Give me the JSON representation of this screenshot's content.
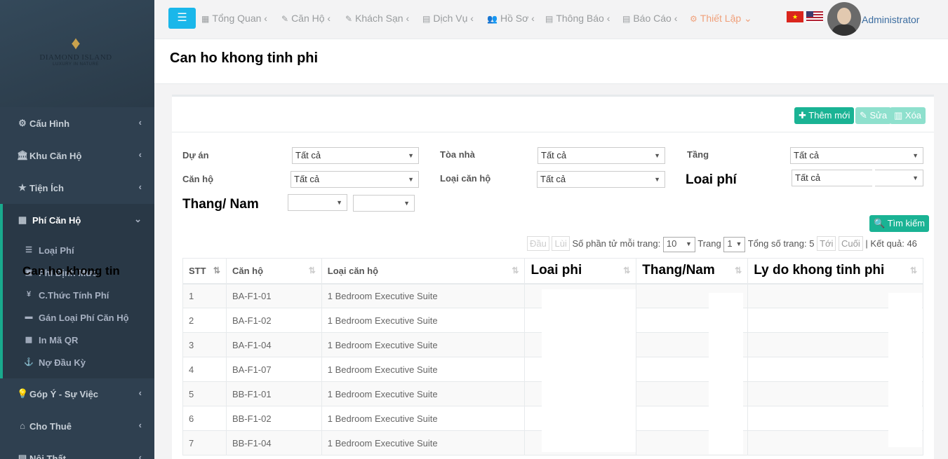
{
  "sidebar": {
    "logo": {
      "brand": "DIAMOND ISLAND",
      "tagline": "LUXURY IN NATURE"
    },
    "items": [
      {
        "label": "Cấu Hình",
        "icon": "gear-icon",
        "glyph": "⚙"
      },
      {
        "label": "Khu Căn Hộ",
        "icon": "bank-icon",
        "glyph": "🏛"
      },
      {
        "label": "Tiện Ích",
        "icon": "star-icon",
        "glyph": "★"
      },
      {
        "label": "Phí Căn Hộ",
        "icon": "building-icon",
        "glyph": "▦"
      },
      {
        "label": "Góp Ý - Sự Việc",
        "icon": "lightbulb-icon",
        "glyph": "💡"
      },
      {
        "label": "Cho Thuê",
        "icon": "home-icon",
        "glyph": "⌂"
      },
      {
        "label": "Nội Thất",
        "icon": "chair-icon",
        "glyph": "▤"
      }
    ],
    "subitems": [
      {
        "label": "Loại Phí",
        "icon": "list-icon",
        "glyph": "☰"
      },
      {
        "label": "Phí Định Mức",
        "icon": "calendar-icon",
        "glyph": "▣"
      },
      {
        "label": "C.Thức Tính Phí",
        "icon": "yen-icon",
        "glyph": "¥"
      },
      {
        "label": "Gán Loại Phí Căn Hộ",
        "icon": "card-icon",
        "glyph": "▬"
      },
      {
        "label": "In Mã QR",
        "icon": "qrcode-icon",
        "glyph": "▩"
      },
      {
        "label": "Nợ Đầu Kỳ",
        "icon": "anchor-icon",
        "glyph": "⚓"
      }
    ],
    "overlay_text": "Can ho khong tin"
  },
  "topnav": {
    "items": [
      {
        "label": "Tổng Quan",
        "glyph": "▦"
      },
      {
        "label": "Căn Hộ",
        "glyph": "✎"
      },
      {
        "label": "Khách Sạn",
        "glyph": "✎"
      },
      {
        "label": "Dịch Vụ",
        "glyph": "▤"
      },
      {
        "label": "Hồ Sơ",
        "glyph": "👥"
      },
      {
        "label": "Thông Báo",
        "glyph": "▤"
      },
      {
        "label": "Báo Cáo",
        "glyph": "▤"
      },
      {
        "label": "Thiết Lập",
        "glyph": "⚙"
      }
    ],
    "chev_left": "‹",
    "chev_down": "⌄",
    "user": "Administrator",
    "flag_vn_star": "★"
  },
  "page": {
    "title": "Can ho khong tinh phi"
  },
  "toolbar": {
    "add": "✚ Thêm mới",
    "edit": "✎ Sửa",
    "delete": "▥ Xóa"
  },
  "filters": {
    "project_label": "Dự án",
    "building_label": "Tòa nhà",
    "floor_label": "Tầng",
    "apartment_label": "Căn hộ",
    "apt_type_label": "Loại căn hộ",
    "fee_type_label": "Loai phí",
    "month_year_label": "Thang/ Nam",
    "all": "Tất cả",
    "search": "🔍 Tìm kiếm"
  },
  "pager": {
    "first": "Đầu",
    "prev": "Lùi",
    "per_page_label": "Số phần tử mỗi trang:",
    "per_page": "10",
    "page_label": "Trang",
    "page": "1",
    "total_pages_label": "Tổng số trang: 5",
    "next": "Tới",
    "last": "Cuối",
    "result_label": "| Kết quả: 46"
  },
  "table": {
    "headers": [
      "STT",
      "Căn hộ",
      "Loại căn hộ",
      "Loai phi",
      "Thang/Nam",
      "Ly do khong tinh phi"
    ],
    "rows": [
      [
        "1",
        "BA-F1-01",
        "1 Bedroom Executive Suite"
      ],
      [
        "2",
        "BA-F1-02",
        "1 Bedroom Executive Suite"
      ],
      [
        "3",
        "BA-F1-04",
        "1 Bedroom Executive Suite"
      ],
      [
        "4",
        "BA-F1-07",
        "1 Bedroom Executive Suite"
      ],
      [
        "5",
        "BB-F1-01",
        "1 Bedroom Executive Suite"
      ],
      [
        "6",
        "BB-F1-02",
        "1 Bedroom Executive Suite"
      ],
      [
        "7",
        "BB-F1-04",
        "1 Bedroom Executive Suite"
      ]
    ]
  }
}
